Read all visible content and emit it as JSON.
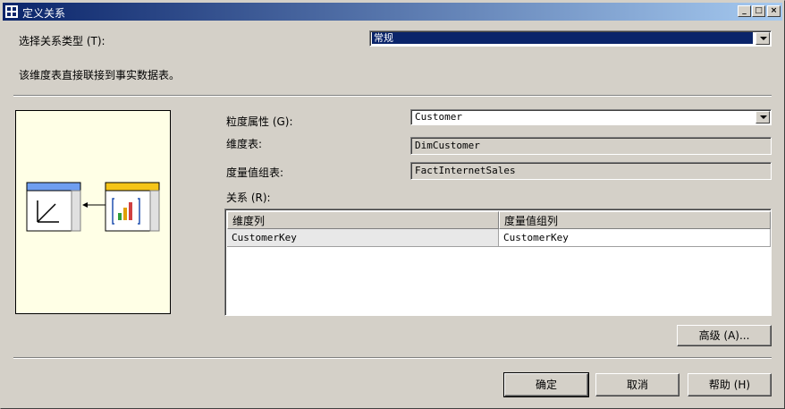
{
  "window": {
    "title": "定义关系"
  },
  "relationship_type": {
    "label": "选择关系类型 (T):",
    "value": "常规"
  },
  "description": "该维度表直接联接到事实数据表。",
  "granularity": {
    "label": "粒度属性 (G):",
    "value": "Customer"
  },
  "dimension_table": {
    "label": "维度表:",
    "value": "DimCustomer"
  },
  "measure_group_table": {
    "label": "度量值组表:",
    "value": "FactInternetSales"
  },
  "relationships": {
    "label": "关系 (R):",
    "columns": [
      "维度列",
      "度量值组列"
    ],
    "rows": [
      [
        "CustomerKey",
        "CustomerKey"
      ]
    ]
  },
  "buttons": {
    "advanced": "高级 (A)...",
    "ok": "确定",
    "cancel": "取消",
    "help": "帮助 (H)"
  },
  "colors": {
    "titlebar_start": "#0a246a",
    "titlebar_end": "#a6caf0",
    "dialog_bg": "#d4d0c8",
    "diagram_bg": "#ffffe6",
    "dimension_header": "#6f9ef0",
    "fact_header": "#f5c518"
  }
}
